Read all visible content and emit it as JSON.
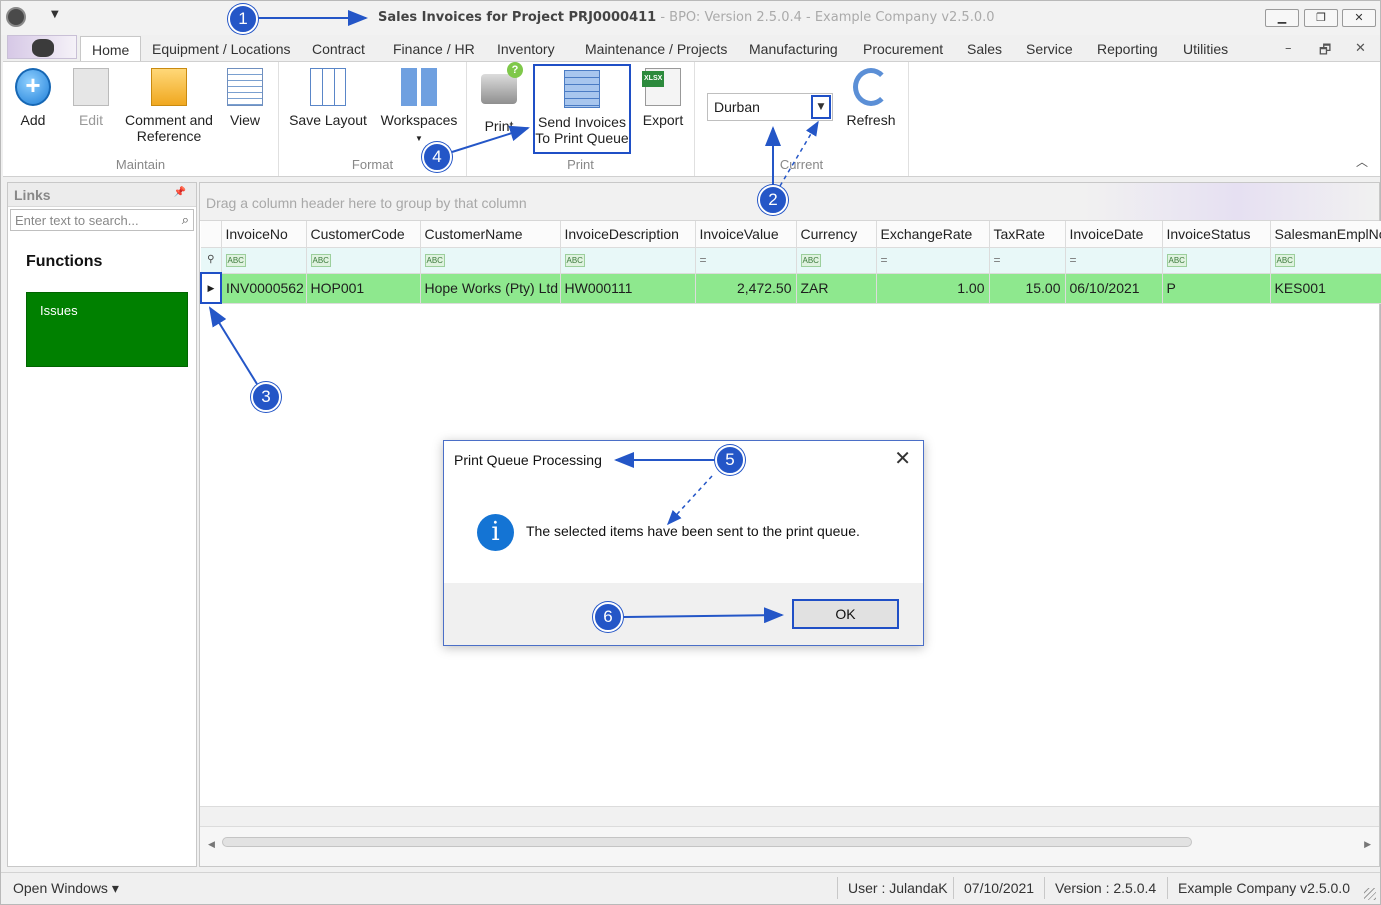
{
  "titlebar": {
    "title_main": "Sales Invoices for Project PRJ0000411",
    "title_suffix": " - BPO: Version 2.5.0.4 - Example Company v2.5.0.0",
    "qat_dropdown_icon": "chevron-down-icon",
    "minimize": "▁",
    "maximize": "❐",
    "close": "✕"
  },
  "tabs": [
    {
      "label": "Home",
      "active": true
    },
    {
      "label": "Equipment / Locations"
    },
    {
      "label": "Contract"
    },
    {
      "label": "Finance / HR"
    },
    {
      "label": "Inventory"
    },
    {
      "label": "Maintenance / Projects"
    },
    {
      "label": "Manufacturing"
    },
    {
      "label": "Procurement"
    },
    {
      "label": "Sales"
    },
    {
      "label": "Service"
    },
    {
      "label": "Reporting"
    },
    {
      "label": "Utilities"
    }
  ],
  "tab_controls": {
    "minimize": "–",
    "restore": "🗗",
    "close": "✕"
  },
  "ribbon": {
    "groups": {
      "maintain": "Maintain",
      "format": "Format",
      "print": "Print",
      "current": "Current"
    },
    "buttons": {
      "add": "Add",
      "edit": "Edit",
      "comment_line1": "Comment and",
      "comment_line2": "Reference",
      "view": "View",
      "save_layout": "Save Layout",
      "workspaces": "Workspaces",
      "print": "Print",
      "send_line1": "Send Invoices",
      "send_line2": "To Print Queue",
      "export": "Export",
      "refresh": "Refresh"
    },
    "branch_value": "Durban",
    "export_badge": "XLSX"
  },
  "links": {
    "header": "Links",
    "search_placeholder": "Enter text to search...",
    "functions_title": "Functions",
    "tiles": [
      {
        "label": "Issues",
        "color": "#008000"
      }
    ]
  },
  "grid": {
    "group_panel_hint": "Drag a column header here to group by that column",
    "columns": [
      "InvoiceNo",
      "CustomerCode",
      "CustomerName",
      "InvoiceDescription",
      "InvoiceValue",
      "Currency",
      "ExchangeRate",
      "TaxRate",
      "InvoiceDate",
      "InvoiceStatus",
      "SalesmanEmplNo"
    ],
    "filter_types": [
      "abc",
      "abc",
      "abc",
      "abc",
      "eq",
      "abc",
      "eq",
      "eq",
      "eq",
      "abc",
      "abc"
    ],
    "rows": [
      [
        "INV0000562",
        "HOP001",
        "Hope Works (Pty) Ltd",
        "HW000111",
        "2,472.50",
        "ZAR",
        "1.00",
        "15.00",
        "06/10/2021",
        "P",
        "KES001"
      ]
    ],
    "selected_row_color": "#8ee88e"
  },
  "statusbar": {
    "open_windows": "Open Windows ▾",
    "user": "User : JulandaK",
    "date": "07/10/2021",
    "version": "Version : 2.5.0.4",
    "company": "Example Company v2.5.0.0"
  },
  "dialog": {
    "title": "Print Queue Processing",
    "message": "The selected items have been sent to the print queue.",
    "ok": "OK",
    "icon": "info-icon"
  },
  "annotations": [
    "1",
    "2",
    "3",
    "4",
    "5",
    "6"
  ],
  "accent_color": "#2456c7"
}
